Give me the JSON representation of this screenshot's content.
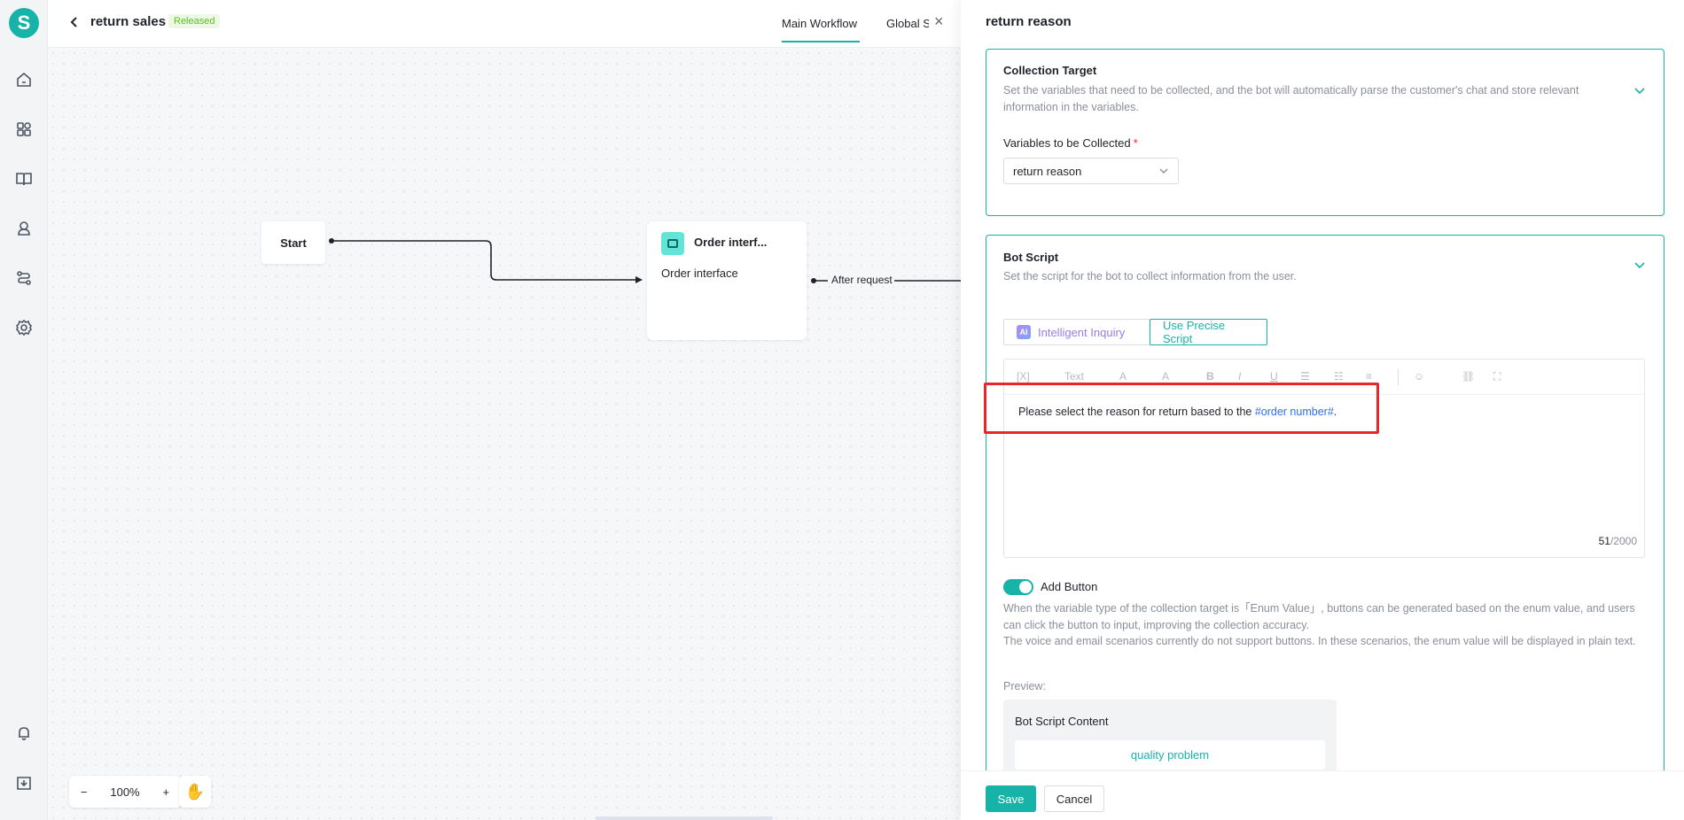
{
  "sidebar": {
    "logo": "S",
    "icons": [
      "home-icon",
      "apps-icon",
      "book-icon",
      "agent-icon",
      "route-icon",
      "settings-icon",
      "bell-icon",
      "download-icon"
    ]
  },
  "header": {
    "title": "return sales",
    "status": "Released",
    "tabs": [
      {
        "label": "Main Workflow",
        "active": true
      },
      {
        "label": "Global S",
        "active": false
      }
    ],
    "close": "×"
  },
  "canvas": {
    "start_node": "Start",
    "order_node": {
      "title": "Order interf...",
      "subtitle": "Order interface"
    },
    "edge_label": "After request",
    "zoom": {
      "minus": "−",
      "level": "100%",
      "plus": "+"
    },
    "hand": "✋"
  },
  "panel": {
    "title": "return reason",
    "collection_target": {
      "title": "Collection Target",
      "description": "Set the variables that need to be collected, and the bot will automatically parse the customer's chat and store relevant information in the variables.",
      "field_label": "Variables to be Collected",
      "required_mark": "*",
      "selected_value": "return reason"
    },
    "bot_script": {
      "title": "Bot Script",
      "description": "Set the script for the bot to collect information from the user.",
      "mode_ai_badge": "AI",
      "mode_ai": "Intelligent Inquiry",
      "mode_precise": "Use Precise Script",
      "toolbar": {
        "var": "[X]",
        "text": "Text",
        "font": "A",
        "bg": "A",
        "bold": "B",
        "italic": "I",
        "underline": "U",
        "ul": "☰",
        "ol": "☷",
        "align": "≡",
        "emoji": "☺",
        "link": "⛓",
        "fullscreen": "⛶"
      },
      "content_prefix": "Please select the reason for  return based to the ",
      "content_var": "#order number#",
      "content_suffix": ".",
      "count": "51",
      "max": "/2000",
      "add_button_label": "Add Button",
      "add_button_enabled": true,
      "add_button_desc_1": "When the variable type of the collection target is「Enum Value」, buttons can be generated based on the enum value, and users can click the button to input, improving the collection accuracy.",
      "add_button_desc_2": "The voice and email scenarios currently do not support buttons. In these scenarios, the enum value will be displayed in plain text.",
      "preview_label": "Preview:",
      "preview_title": "Bot Script Content",
      "preview_button": "quality problem"
    },
    "footer": {
      "save": "Save",
      "cancel": "Cancel"
    }
  },
  "colors": {
    "accent": "#17b3a8",
    "highlight": "#e8262b",
    "variable": "#2b6df4",
    "released": "#52c41a"
  }
}
